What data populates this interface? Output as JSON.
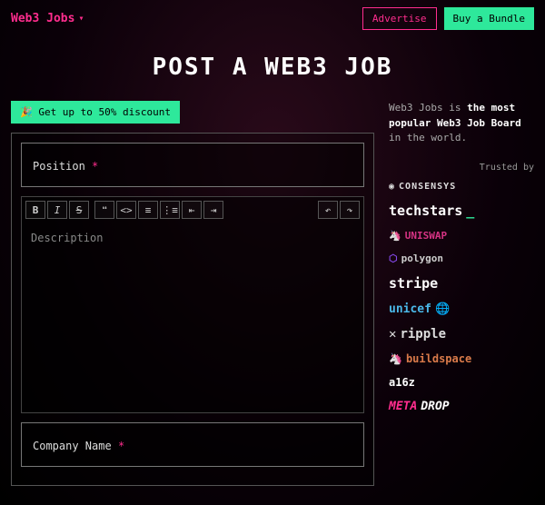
{
  "header": {
    "brand": "Web3 Jobs",
    "advertise": "Advertise",
    "bundle": "Buy a Bundle"
  },
  "title": "POST A WEB3 JOB",
  "discount_label": "🎉 Get up to 50% discount",
  "form": {
    "position_label": "Position",
    "description_placeholder": "Description",
    "company_label": "Company Name"
  },
  "sidebar": {
    "tagline_prefix": "Web3 Jobs is ",
    "tagline_bold": "the most popular Web3 Job Board",
    "tagline_suffix": " in the world.",
    "trusted_by": "Trusted by",
    "logos": {
      "consensys": "CONSENSYS",
      "techstars": "techstars",
      "uniswap": "UNISWAP",
      "polygon": "polygon",
      "stripe": "stripe",
      "unicef": "unicef",
      "ripple": "ripple",
      "buildspace": "buildspace",
      "a16z": "a16z",
      "metadrop_m": "META",
      "metadrop_d": "DROP"
    }
  }
}
